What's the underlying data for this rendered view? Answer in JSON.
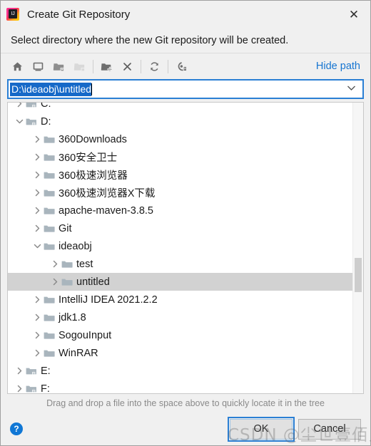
{
  "window": {
    "title": "Create Git Repository",
    "app_icon": "intellij-idea-icon",
    "close_label": "✕"
  },
  "prompt": {
    "text": "Select directory where the new Git repository will be created."
  },
  "toolbar": {
    "buttons": [
      {
        "name": "home-icon",
        "tooltip": "Home",
        "disabled": false
      },
      {
        "name": "desktop-icon",
        "tooltip": "Desktop",
        "disabled": false
      },
      {
        "name": "folder-project-icon",
        "tooltip": "Project",
        "disabled": false
      },
      {
        "name": "folder-module-icon",
        "tooltip": "Module",
        "disabled": true
      },
      {
        "name": "new-folder-icon",
        "tooltip": "New Folder",
        "disabled": false
      },
      {
        "name": "delete-icon",
        "tooltip": "Delete",
        "disabled": false
      },
      {
        "name": "refresh-icon",
        "tooltip": "Refresh",
        "disabled": false
      },
      {
        "name": "show-hidden-icon",
        "tooltip": "Show Hidden Files",
        "disabled": false
      }
    ],
    "hide_path_label": "Hide path"
  },
  "path_field": {
    "value": "D:\\ideaobj\\untitled",
    "placeholder": "",
    "selected": true,
    "dropdown_arrow": "⌄"
  },
  "tree": {
    "rows": [
      {
        "label": "C:",
        "depth": 0,
        "expanded": false,
        "kind": "drive",
        "selected": false,
        "clipped": true
      },
      {
        "label": "D:",
        "depth": 0,
        "expanded": true,
        "kind": "drive",
        "selected": false
      },
      {
        "label": "360Downloads",
        "depth": 1,
        "expanded": false,
        "kind": "folder",
        "selected": false
      },
      {
        "label": "360安全卫士",
        "depth": 1,
        "expanded": false,
        "kind": "folder",
        "selected": false
      },
      {
        "label": "360极速浏览器",
        "depth": 1,
        "expanded": false,
        "kind": "folder",
        "selected": false
      },
      {
        "label": "360极速浏览器X下载",
        "depth": 1,
        "expanded": false,
        "kind": "folder",
        "selected": false
      },
      {
        "label": "apache-maven-3.8.5",
        "depth": 1,
        "expanded": false,
        "kind": "folder",
        "selected": false
      },
      {
        "label": "Git",
        "depth": 1,
        "expanded": false,
        "kind": "folder",
        "selected": false
      },
      {
        "label": "ideaobj",
        "depth": 1,
        "expanded": true,
        "kind": "folder",
        "selected": false
      },
      {
        "label": "test",
        "depth": 2,
        "expanded": false,
        "kind": "folder",
        "selected": false
      },
      {
        "label": "untitled",
        "depth": 2,
        "expanded": false,
        "kind": "folder",
        "selected": true
      },
      {
        "label": "IntelliJ IDEA 2021.2.2",
        "depth": 1,
        "expanded": false,
        "kind": "folder",
        "selected": false
      },
      {
        "label": "jdk1.8",
        "depth": 1,
        "expanded": false,
        "kind": "folder",
        "selected": false
      },
      {
        "label": "SogouInput",
        "depth": 1,
        "expanded": false,
        "kind": "folder",
        "selected": false
      },
      {
        "label": "WinRAR",
        "depth": 1,
        "expanded": false,
        "kind": "folder",
        "selected": false
      },
      {
        "label": "E:",
        "depth": 0,
        "expanded": false,
        "kind": "drive",
        "selected": false
      },
      {
        "label": "F:",
        "depth": 0,
        "expanded": false,
        "kind": "drive",
        "selected": false
      }
    ]
  },
  "hint": {
    "text": "Drag and drop a file into the space above to quickly locate it in the tree"
  },
  "footer": {
    "help_label": "?",
    "ok_label": "OK",
    "cancel_label": "Cancel"
  },
  "watermark": {
    "text": "CSDN @尘世壹佰人"
  },
  "colors": {
    "accent_blue": "#1675d1",
    "selection_blue": "#1669c8",
    "focus_border": "#2a7fd4",
    "row_selected": "#d2d2d2",
    "folder_fill": "#a9b5bd",
    "dialog_bg": "#f0f0f0"
  }
}
